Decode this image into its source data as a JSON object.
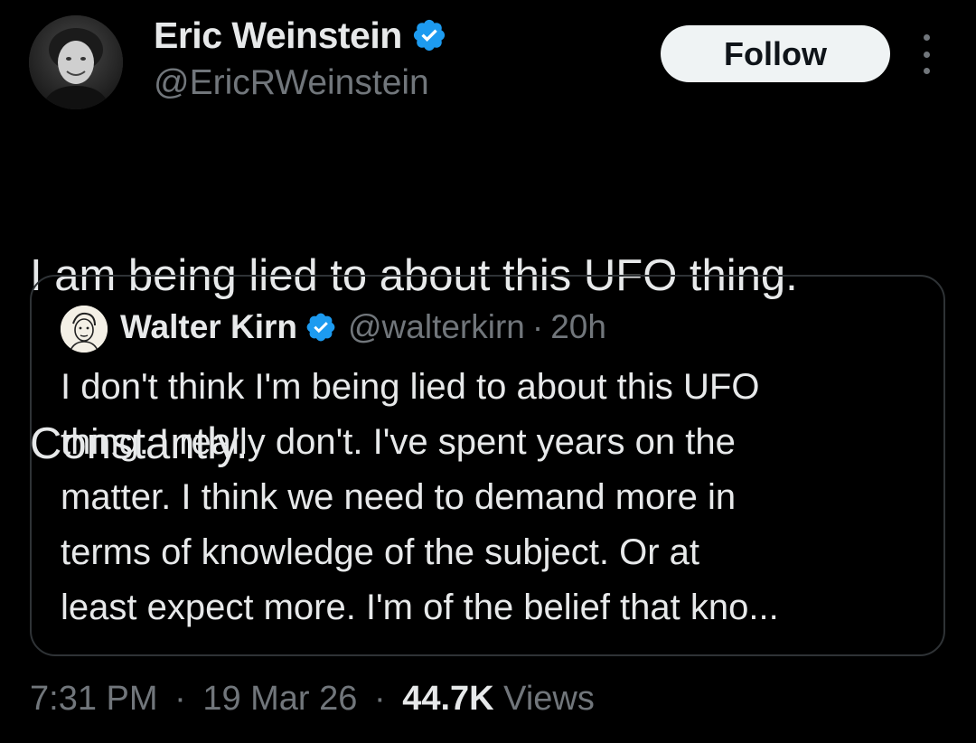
{
  "author": {
    "display_name": "Eric Weinstein",
    "handle": "@EricRWeinstein",
    "verified_icon": "verified-badge-icon",
    "avatar_icon": "user-avatar"
  },
  "actions": {
    "follow_label": "Follow",
    "more_icon": "more-options-icon"
  },
  "tweet": {
    "text_line1": "I am being lied to about this UFO thing.",
    "text_line2": "Constantly."
  },
  "quote": {
    "display_name": "Walter Kirn",
    "handle": "@walterkirn",
    "separator": "·",
    "time": "20h",
    "lines": [
      "I don't think I'm being lied to about this UFO",
      "thing. I really don't. I've spent years on the",
      "matter. I think we need to demand more in",
      "terms of knowledge of the subject. Or at",
      "least expect more. I'm of the belief that kno..."
    ]
  },
  "meta": {
    "time": "7:31 PM",
    "sep1": "·",
    "date": "19 Mar 26",
    "sep2": "·",
    "views_count": "44.7K",
    "views_label": "Views"
  },
  "colors": {
    "background": "#000000",
    "text_primary": "#e7e9ea",
    "text_secondary": "#71767b",
    "verified_blue": "#1d9bf0",
    "border": "#2f3336",
    "button_bg": "#eff3f4"
  }
}
